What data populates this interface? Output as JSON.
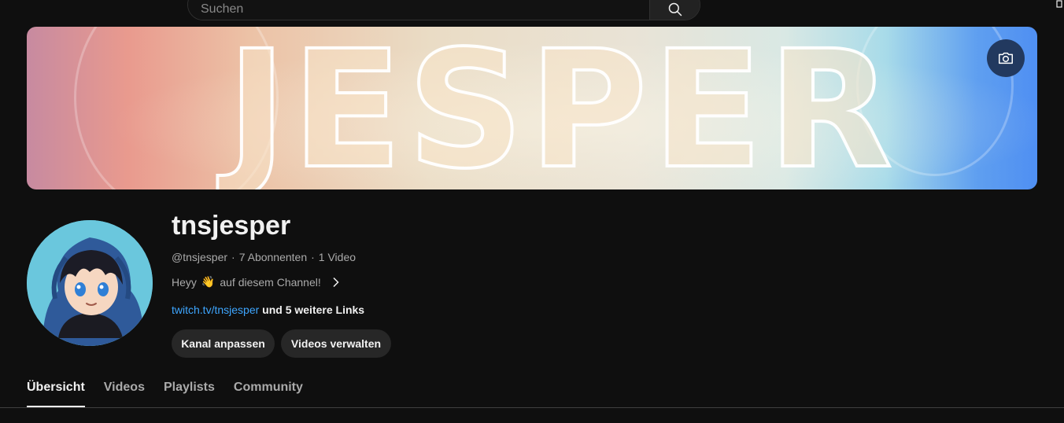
{
  "search": {
    "placeholder": "Suchen"
  },
  "banner": {
    "text": "JESPER"
  },
  "channel": {
    "name": "tnsjesper",
    "handle": "@tnsjesper",
    "subscribers": "7 Abonnenten",
    "videos": "1 Video",
    "description_before": "Heyy",
    "description_emoji": "👋",
    "description_after": "auf diesem Channel!",
    "link": "twitch.tv/tnsjesper",
    "more_links": "und 5 weitere Links"
  },
  "actions": {
    "customize_label": "Kanal anpassen",
    "manage_label": "Videos verwalten"
  },
  "tabs": [
    {
      "label": "Übersicht",
      "active": true
    },
    {
      "label": "Videos",
      "active": false
    },
    {
      "label": "Playlists",
      "active": false
    },
    {
      "label": "Community",
      "active": false
    }
  ],
  "colors": {
    "background": "#0f0f0f",
    "link": "#3ea6ff",
    "camera_button": "#22395f"
  },
  "icons": {
    "search": "search-icon",
    "camera": "camera-icon",
    "chevron": "chevron-right-icon"
  }
}
